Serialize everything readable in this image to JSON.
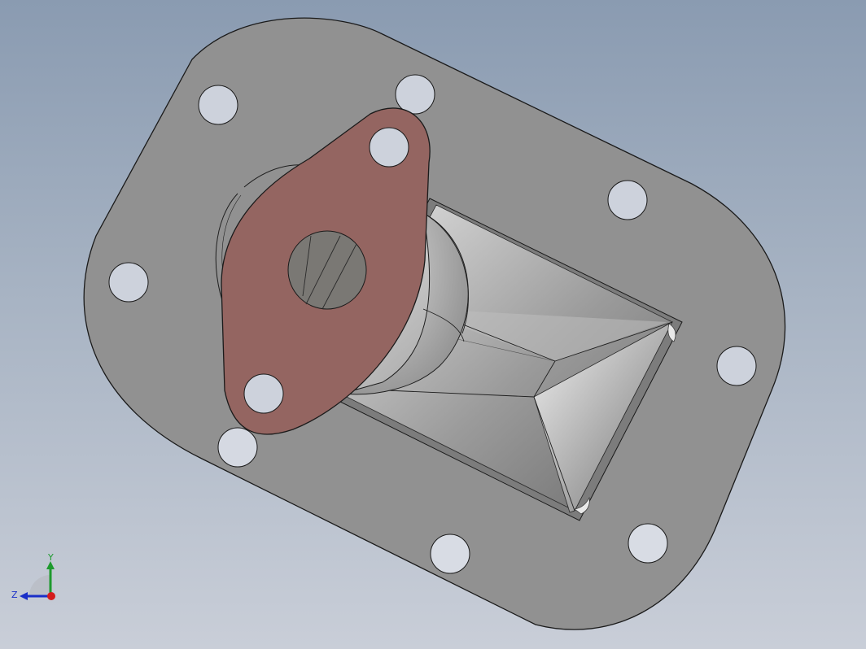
{
  "viewport": {
    "background_top": "#8a9bb1",
    "background_bottom": "#c9ced8"
  },
  "model": {
    "plate_color": "#919191",
    "flange_color": "#946561",
    "hole_color": "#cdd2dc",
    "outline_color": "#1a1a1a"
  },
  "triad": {
    "y_label": "Y",
    "z_label": "Z",
    "y_color": "#1e9a2e",
    "z_color": "#1a2fc8",
    "x_color": "#d41c1c"
  }
}
